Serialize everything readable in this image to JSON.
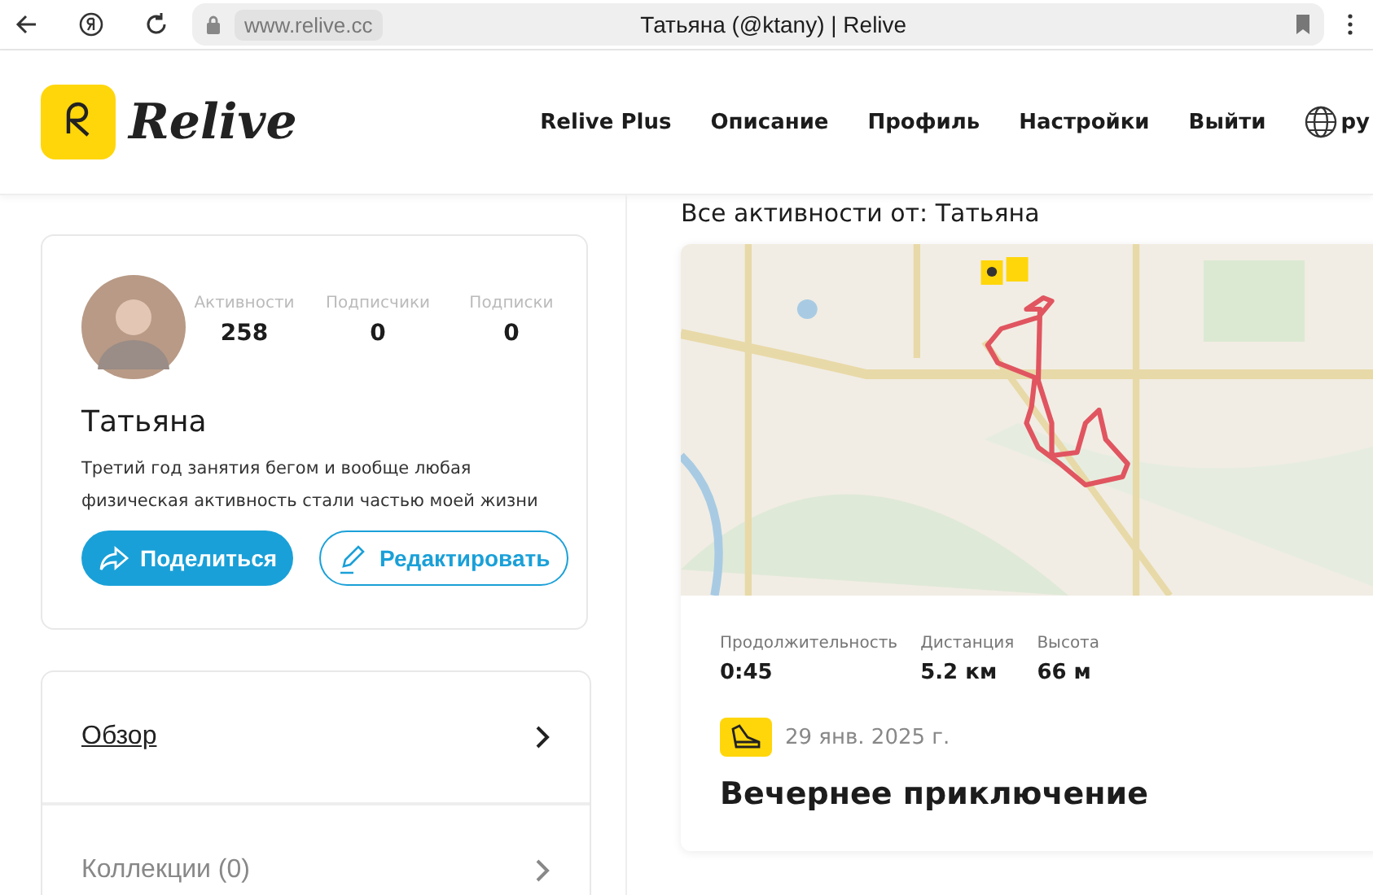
{
  "browser": {
    "address": "www.relive.cc",
    "title": "Татьяна (@ktany) | Relive"
  },
  "header": {
    "logo": "Relive",
    "nav": [
      "Relive Plus",
      "Описание",
      "Профиль",
      "Настройки",
      "Выйти"
    ],
    "language": "ру"
  },
  "profile": {
    "stats": [
      {
        "label": "Активности",
        "value": "258"
      },
      {
        "label": "Подписчики",
        "value": "0"
      },
      {
        "label": "Подписки",
        "value": "0"
      }
    ],
    "name": "Татьяна",
    "bio": "Третий год занятия бегом и вообще любая физическая активность стали частью моей жизни",
    "buttons": [
      {
        "kind": "share",
        "label": "Поделиться"
      },
      {
        "kind": "edit",
        "label": "Редактировать"
      }
    ]
  },
  "menu": [
    {
      "label": "Обзор",
      "selected": true
    },
    {
      "label": "Коллекции (0)",
      "selected": false
    }
  ],
  "feed": {
    "heading": "Все активности от: Татьяна",
    "activity": {
      "stats": [
        {
          "label": "Продолжительность",
          "value": "0:45"
        },
        {
          "label": "Дистанция",
          "value": "5.2 км"
        },
        {
          "label": "Высота",
          "value": "66 м"
        }
      ],
      "date": "29 янв. 2025 г.",
      "title": "Вечернее приключение"
    }
  }
}
